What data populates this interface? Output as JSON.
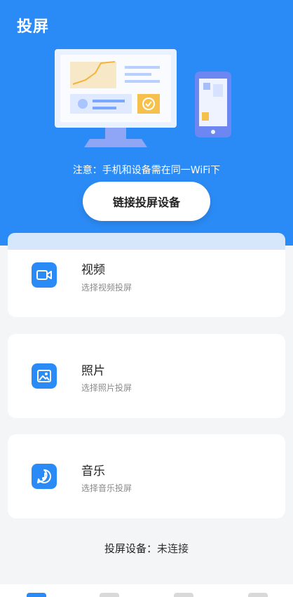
{
  "header": {
    "title": "投屏"
  },
  "notice": "注意：手机和设备需在同一WiFi下",
  "connect_button": "链接投屏设备",
  "options": [
    {
      "name": "视频",
      "desc": "选择视频投屏",
      "icon": "video-camera-icon"
    },
    {
      "name": "照片",
      "desc": "选择照片投屏",
      "icon": "image-icon"
    },
    {
      "name": "音乐",
      "desc": "选择音乐投屏",
      "icon": "music-note-icon"
    }
  ],
  "status": {
    "label": "投屏设备：",
    "value": "未连接"
  },
  "colors": {
    "primary": "#2b8bf6",
    "panel_tint": "#d6e7fb"
  },
  "tabbar": {
    "active_index": 0
  }
}
